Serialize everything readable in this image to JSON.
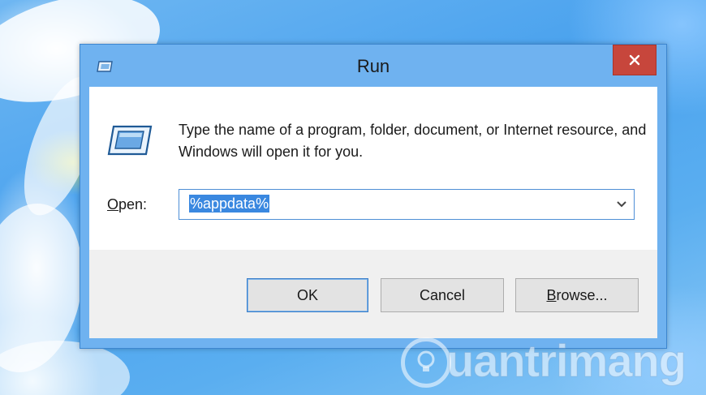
{
  "window": {
    "title": "Run",
    "close_glyph": "✕"
  },
  "dialog": {
    "description": "Type the name of a program, folder, document, or Internet resource, and Windows will open it for you.",
    "open_label_underlined": "O",
    "open_label_rest": "pen:",
    "open_value": "%appdata%"
  },
  "buttons": {
    "ok": "OK",
    "cancel": "Cancel",
    "browse_underlined": "B",
    "browse_rest": "rowse..."
  },
  "watermark": {
    "text": "uantrimang"
  },
  "colors": {
    "frame": "#6fb2f0",
    "close_button": "#c7463c",
    "selection": "#3a88e0",
    "client": "#ffffff",
    "footer": "#f0f0f0"
  },
  "icons": {
    "title": "run-icon",
    "body": "run-icon",
    "close": "close-icon",
    "dropdown": "chevron-down-icon",
    "watermark": "lightbulb-icon"
  }
}
